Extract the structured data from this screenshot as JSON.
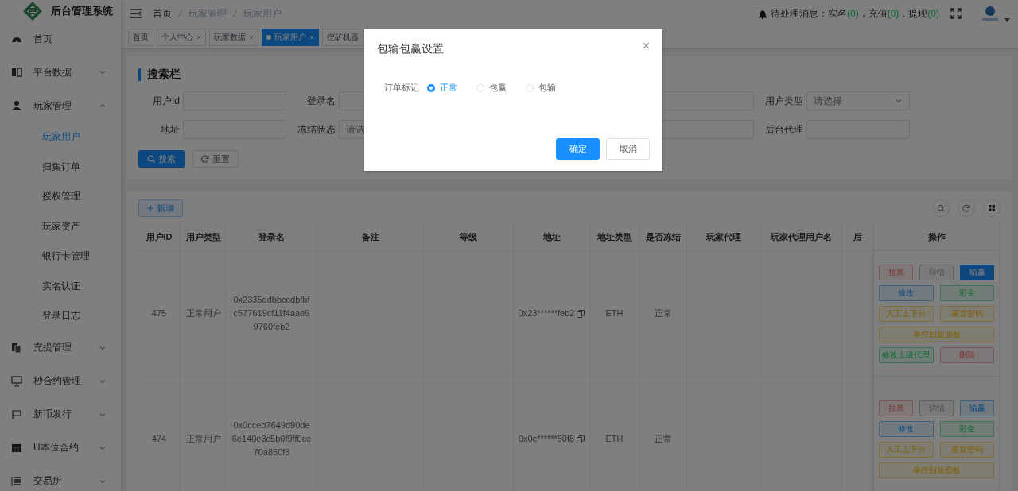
{
  "sidebar": {
    "logo": "后台管理系统",
    "items": [
      {
        "label": "首页",
        "kind": "link"
      },
      {
        "label": "平台数据",
        "kind": "submenu",
        "expanded": false
      },
      {
        "label": "玩家管理",
        "kind": "submenu",
        "expanded": true,
        "children": [
          {
            "label": "玩家用户",
            "selected": true
          },
          {
            "label": "归集订单",
            "selected": false
          },
          {
            "label": "授权管理",
            "selected": false
          },
          {
            "label": "玩家资产",
            "selected": false
          },
          {
            "label": "银行卡管理",
            "selected": false
          },
          {
            "label": "实名认证",
            "selected": false
          },
          {
            "label": "登录日志",
            "selected": false
          }
        ]
      },
      {
        "label": "充提管理",
        "kind": "submenu",
        "expanded": false
      },
      {
        "label": "秒合约管理",
        "kind": "submenu",
        "expanded": false
      },
      {
        "label": "新币发行",
        "kind": "submenu",
        "expanded": false
      },
      {
        "label": "U本位合约",
        "kind": "submenu",
        "expanded": false
      },
      {
        "label": "交易所",
        "kind": "submenu",
        "expanded": false
      }
    ]
  },
  "header": {
    "breadcrumb": [
      "首页",
      "玩家管理",
      "玩家用户"
    ],
    "notice": {
      "label": "待处理消息：",
      "items": [
        {
          "name": "实名",
          "count": "(0)",
          "sep": "，"
        },
        {
          "name": "充值",
          "count": "(0)",
          "sep": "，"
        },
        {
          "name": "提现",
          "count": "(0)"
        }
      ]
    }
  },
  "tabs": [
    {
      "label": "首页",
      "closable": false,
      "selected": false
    },
    {
      "label": "个人中心",
      "closable": true,
      "selected": false
    },
    {
      "label": "玩家数据",
      "closable": true,
      "selected": false
    },
    {
      "label": "玩家用户",
      "closable": true,
      "selected": true
    },
    {
      "label": "挖矿机器",
      "closable": false,
      "selected": false
    }
  ],
  "search": {
    "title": "搜索栏",
    "fields": [
      {
        "label": "用户Id",
        "kind": "input"
      },
      {
        "label": "登录名",
        "kind": "input"
      },
      {
        "kind": "input"
      },
      {
        "label": "用户类型",
        "kind": "select",
        "placeholder": "请选择"
      },
      {
        "label": "地址",
        "kind": "input"
      },
      {
        "label": "冻结状态",
        "kind": "select",
        "placeholder": "请选"
      },
      {
        "kind": "input"
      },
      {
        "label": "后台代理",
        "kind": "input"
      }
    ],
    "buttons": [
      {
        "label": "搜索",
        "kind": "primary"
      },
      {
        "label": "重置",
        "kind": "default"
      }
    ]
  },
  "table": {
    "add_button": "新增",
    "columns": [
      {
        "label": "用户ID"
      },
      {
        "label": "用户类型"
      },
      {
        "label": "登录名"
      },
      {
        "label": "备注"
      },
      {
        "label": "等级"
      },
      {
        "label": "地址",
        "kind": "address"
      },
      {
        "label": "地址类型"
      },
      {
        "label": "是否冻结"
      },
      {
        "label": "玩家代理"
      },
      {
        "label": "玩家代理用户名"
      },
      {
        "label": "后"
      },
      {
        "label": "操作"
      }
    ],
    "rows": [
      {
        "cells": [
          "475",
          "正常用户",
          "0x2335ddbbccdbfbfc577619cf11f4aae99760feb2",
          "",
          "",
          "0x23******feb2",
          "ETH",
          "正常",
          "",
          "",
          ""
        ],
        "actions": [
          [
            {
              "label": "拉黑",
              "kind": "danger",
              "solid": false
            },
            {
              "label": "详情",
              "kind": "info",
              "solid": false
            },
            {
              "label": "输赢",
              "kind": "primary",
              "solid": true
            }
          ],
          [
            {
              "label": "修改",
              "kind": "primary",
              "solid": false
            },
            {
              "label": "彩金",
              "kind": "success",
              "solid": false
            }
          ],
          [
            {
              "label": "人工上下分",
              "kind": "warning",
              "solid": false
            },
            {
              "label": "重置密码",
              "kind": "warning",
              "solid": false
            }
          ],
          [
            {
              "label": "单控回旋面板",
              "kind": "warning",
              "solid": false
            }
          ],
          [
            {
              "label": "修改上级代理",
              "kind": "success",
              "solid": false
            },
            {
              "label": "删除",
              "kind": "danger",
              "solid": false
            }
          ]
        ]
      },
      {
        "cells": [
          "474",
          "正常用户",
          "0x0cceb7649d90de6e140e3c5b0f9ff0ce70a850f8",
          "",
          "",
          "0x0c******50f8",
          "ETH",
          "正常",
          "",
          "",
          ""
        ],
        "actions": [
          [
            {
              "label": "拉黑",
              "kind": "danger",
              "solid": false
            },
            {
              "label": "详情",
              "kind": "info",
              "solid": false
            },
            {
              "label": "输赢",
              "kind": "primary",
              "solid": false
            }
          ],
          [
            {
              "label": "修改",
              "kind": "primary",
              "solid": false
            },
            {
              "label": "彩金",
              "kind": "success",
              "solid": false
            }
          ],
          [
            {
              "label": "人工上下分",
              "kind": "warning",
              "solid": false
            },
            {
              "label": "重置密码",
              "kind": "warning",
              "solid": false
            }
          ],
          [
            {
              "label": "单控回旋面板",
              "kind": "warning",
              "solid": false
            }
          ]
        ]
      }
    ]
  },
  "dialog": {
    "title": "包输包赢设置",
    "field_label": "订单标记",
    "options": [
      {
        "label": "正常",
        "selected": true
      },
      {
        "label": "包赢",
        "selected": false
      },
      {
        "label": "包输",
        "selected": false
      }
    ],
    "buttons": [
      {
        "label": "确定",
        "kind": "primary"
      },
      {
        "label": "取消",
        "kind": "default"
      }
    ]
  }
}
